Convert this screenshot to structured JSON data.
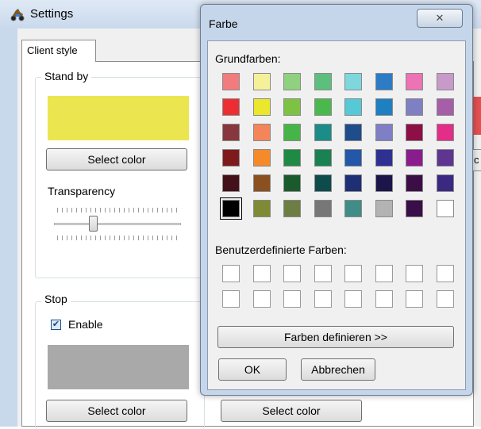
{
  "settings": {
    "title": "Settings",
    "tab": "Client style",
    "standby": {
      "legend": "Stand by",
      "swatch_color": "#ebe64f",
      "select_label": "Select color",
      "transparency_label": "Transparency",
      "transparency_value": 0.35
    },
    "stop": {
      "legend": "Stop",
      "enable_label": "Enable",
      "enable_checked": true,
      "swatch_color": "#a9a9a9",
      "select_label": "Select color"
    },
    "second_column": {
      "select_label": "Select color"
    },
    "edge_swatch_color": "#e25050",
    "edge_button_text": "c"
  },
  "farbe": {
    "title": "Farbe",
    "close_glyph": "✕",
    "basic_label": "Grundfarben:",
    "basic_colors": [
      [
        "#f27b7d",
        "#f5f09a",
        "#8fd17e",
        "#5dbf7d",
        "#7fd7de",
        "#2e7bc5",
        "#eb73b6",
        "#c79ac9"
      ],
      [
        "#ec2e32",
        "#eae72c",
        "#7dc243",
        "#4ab84d",
        "#57c8d6",
        "#1e7fc1",
        "#7f7fc3",
        "#a65ea8"
      ],
      [
        "#87373d",
        "#f4845a",
        "#46b549",
        "#1b8c87",
        "#1f4c8b",
        "#7f7fc6",
        "#8c0f45",
        "#e32d88"
      ],
      [
        "#7f1a1c",
        "#f58a2a",
        "#1f8a43",
        "#1a8153",
        "#2357a8",
        "#2e3192",
        "#8a1d8c",
        "#5f3592"
      ],
      [
        "#44101a",
        "#8a501f",
        "#1a5a2d",
        "#0d4b4c",
        "#1f2f75",
        "#1b1549",
        "#3b0f46",
        "#3b2882"
      ],
      [
        "#000000",
        "#7f8a35",
        "#6d7d43",
        "#777777",
        "#3f8d86",
        "#b3b3b3",
        "#3a0e48",
        "#ffffff"
      ]
    ],
    "selected_index": [
      5,
      0
    ],
    "custom_label": "Benutzerdefinierte Farben:",
    "custom_colors": [
      [
        "#ffffff",
        "#ffffff",
        "#ffffff",
        "#ffffff",
        "#ffffff",
        "#ffffff",
        "#ffffff",
        "#ffffff"
      ],
      [
        "#ffffff",
        "#ffffff",
        "#ffffff",
        "#ffffff",
        "#ffffff",
        "#ffffff",
        "#ffffff",
        "#ffffff"
      ]
    ],
    "define_button": "Farben definieren >>",
    "ok_button": "OK",
    "cancel_button": "Abbrechen"
  }
}
